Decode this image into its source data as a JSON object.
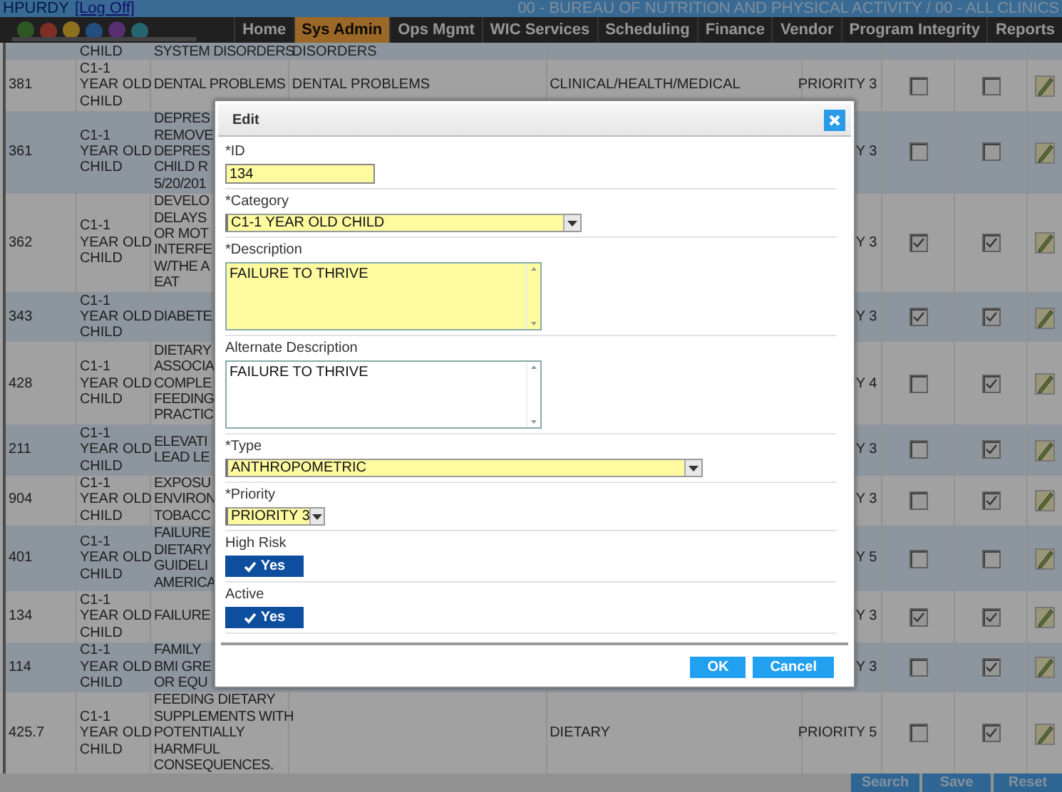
{
  "top_bar": {
    "user": "HPURDY",
    "log_off": "[Log Off]",
    "title": "00 - BUREAU OF NUTRITION AND PHYSICAL ACTIVITY / 00 - ALL CLINICS"
  },
  "nav": [
    {
      "label": "Home",
      "selected": false
    },
    {
      "label": "Sys Admin",
      "selected": true
    },
    {
      "label": "Ops Mgmt",
      "selected": false
    },
    {
      "label": "WIC Services",
      "selected": false
    },
    {
      "label": "Scheduling",
      "selected": false
    },
    {
      "label": "Finance",
      "selected": false
    },
    {
      "label": "Vendor",
      "selected": false
    },
    {
      "label": "Program Integrity",
      "selected": false
    },
    {
      "label": "Reports",
      "selected": false
    }
  ],
  "table": {
    "rows": [
      {
        "category": "CHILD",
        "description": "SYSTEM DISORDERS",
        "alternate_description": "DISORDERS"
      },
      {
        "id": "381",
        "category": "C1-1\nYEAR OLD\nCHILD",
        "description": "DENTAL PROBLEMS",
        "alternate_description": "DENTAL PROBLEMS",
        "type": "CLINICAL/HEALTH/MEDICAL",
        "priority": "PRIORITY 3",
        "high_risk": false,
        "active": false
      },
      {
        "id": "361",
        "category": "C1-1\nYEAR OLD\nCHILD",
        "description": "DEPRES\nREMOVE\nDEPRES\nCHILD R\n5/20/201",
        "priority": "Y 3",
        "high_risk": false,
        "active": false
      },
      {
        "id": "362",
        "category": "C1-1\nYEAR OLD\nCHILD",
        "description": "DEVELO\nDELAYS\nOR MOT\nINTERFE\nW/THE A\nEAT",
        "priority": "Y 3",
        "high_risk": true,
        "active": true
      },
      {
        "id": "343",
        "category": "C1-1\nYEAR OLD\nCHILD",
        "description": "DIABETE",
        "priority": "Y 3",
        "high_risk": true,
        "active": true
      },
      {
        "id": "428",
        "category": "C1-1\nYEAR OLD\nCHILD",
        "description": "DIETARY\nASSOCIA\nCOMPLE\nFEEDING\nPRACTIC",
        "priority": "Y 4",
        "high_risk": false,
        "active": true
      },
      {
        "id": "211",
        "category": "C1-1\nYEAR OLD\nCHILD",
        "description": "ELEVATI\nLEAD LE",
        "priority": "Y 3",
        "high_risk": false,
        "active": true
      },
      {
        "id": "904",
        "category": "C1-1\nYEAR OLD\nCHILD",
        "description": "EXPOSU\nENVIRON\nTOBACC",
        "priority": "Y 3",
        "high_risk": false,
        "active": true
      },
      {
        "id": "401",
        "category": "C1-1\nYEAR OLD\nCHILD",
        "description": "FAILURE\nDIETARY\nGUIDELI\nAMERICA",
        "priority": "Y 5",
        "high_risk": false,
        "active": false
      },
      {
        "id": "134",
        "category": "C1-1\nYEAR OLD\nCHILD",
        "description": "FAILURE",
        "priority": "Y 3",
        "high_risk": true,
        "active": true
      },
      {
        "id": "114",
        "category": "C1-1\nYEAR OLD\nCHILD",
        "description": "FAMILY\nBMI GRE\nOR EQU",
        "priority": "Y 3",
        "high_risk": false,
        "active": true
      },
      {
        "id": "425.7",
        "category": "C1-1\nYEAR OLD\nCHILD",
        "description": "FEEDING DIETARY\nSUPPLEMENTS WITH\nPOTENTIALLY\nHARMFUL\nCONSEQUENCES.",
        "type": "DIETARY",
        "priority": "PRIORITY 5",
        "high_risk": false,
        "active": true
      }
    ]
  },
  "dialog": {
    "title": "Edit",
    "fields": [
      {
        "kind": "text",
        "label": "*ID",
        "value": "134",
        "required": true
      },
      {
        "kind": "select",
        "label": "*Category",
        "value": "C1-1 YEAR OLD CHILD",
        "required": true
      },
      {
        "kind": "textarea",
        "label": "*Description",
        "value": "FAILURE TO THRIVE",
        "required": true
      },
      {
        "kind": "textarea",
        "label": "Alternate Description",
        "value": "FAILURE TO THRIVE",
        "required": false
      },
      {
        "kind": "select",
        "label": "*Type",
        "value": "ANTHROPOMETRIC",
        "required": true
      },
      {
        "kind": "select",
        "label": "*Priority",
        "value": "PRIORITY 3",
        "required": true
      },
      {
        "kind": "toggle",
        "label": "High Risk",
        "value": "Yes",
        "on": true
      },
      {
        "kind": "toggle",
        "label": "Active",
        "value": "Yes",
        "on": true
      }
    ],
    "buttons": [
      "OK",
      "Cancel"
    ]
  },
  "footer_buttons": [
    "Search",
    "Save",
    "Reset"
  ]
}
